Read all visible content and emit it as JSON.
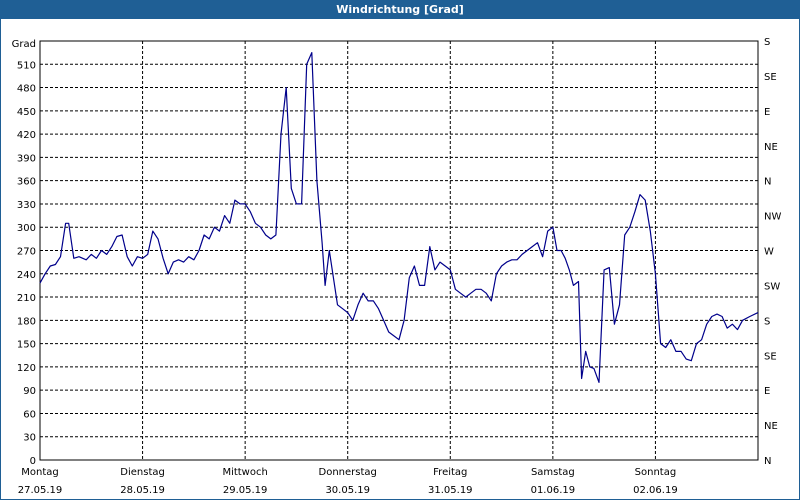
{
  "window": {
    "title": "Windrichtung [Grad]"
  },
  "chart_data": {
    "type": "line",
    "title": "Windrichtung [Grad]",
    "ylabel": "Grad",
    "ylim": [
      0,
      540
    ],
    "yticks": [
      0,
      30,
      60,
      90,
      120,
      150,
      180,
      210,
      240,
      270,
      300,
      330,
      360,
      390,
      420,
      450,
      480,
      510
    ],
    "right_axis_labels": [
      "S",
      "SE",
      "E",
      "NE",
      "N",
      "NW",
      "W",
      "SW",
      "S",
      "SE",
      "E",
      "NE",
      "N"
    ],
    "grid": true,
    "x_day_labels": [
      {
        "day": "Montag",
        "date": "27.05.19"
      },
      {
        "day": "Dienstag",
        "date": "28.05.19"
      },
      {
        "day": "Mittwoch",
        "date": "29.05.19"
      },
      {
        "day": "Donnerstag",
        "date": "30.05.19"
      },
      {
        "day": "Freitag",
        "date": "31.05.19"
      },
      {
        "day": "Samstag",
        "date": "01.06.19"
      },
      {
        "day": "Sonntag",
        "date": "02.06.19"
      }
    ],
    "line_color": "#00008b",
    "series": [
      {
        "x_days": [
          0.0,
          0.05,
          0.1,
          0.15,
          0.2,
          0.25,
          0.28,
          0.33,
          0.38,
          0.45,
          0.5,
          0.55,
          0.6,
          0.65,
          0.7,
          0.75,
          0.8,
          0.85,
          0.9,
          0.95,
          1.0,
          1.05,
          1.1,
          1.15,
          1.2,
          1.25,
          1.3,
          1.35,
          1.4,
          1.45,
          1.5,
          1.55,
          1.6,
          1.65,
          1.7,
          1.75,
          1.8,
          1.85,
          1.9,
          1.95,
          2.0,
          2.05,
          2.1,
          2.15,
          2.2,
          2.25,
          2.3,
          2.35,
          2.4,
          2.45,
          2.5,
          2.55,
          2.6,
          2.65,
          2.7,
          2.75,
          2.78,
          2.82,
          2.9,
          2.95,
          3.0,
          3.05,
          3.1,
          3.15,
          3.2,
          3.25,
          3.3,
          3.35,
          3.4,
          3.45,
          3.5,
          3.55,
          3.6,
          3.65,
          3.7,
          3.75,
          3.8,
          3.85,
          3.9,
          3.95,
          4.0,
          4.05,
          4.1,
          4.15,
          4.2,
          4.25,
          4.3,
          4.35,
          4.4,
          4.45,
          4.5,
          4.55,
          4.6,
          4.65,
          4.7,
          4.75,
          4.8,
          4.85,
          4.9,
          4.95,
          5.0,
          5.04,
          5.08,
          5.12,
          5.16,
          5.2,
          5.25,
          5.28,
          5.32,
          5.36,
          5.4,
          5.45,
          5.5,
          5.55,
          5.6,
          5.65,
          5.7,
          5.75,
          5.8,
          5.85,
          5.9,
          5.95,
          6.0,
          6.05,
          6.1,
          6.15,
          6.2,
          6.25,
          6.3,
          6.35,
          6.4,
          6.45,
          6.5,
          6.55,
          6.6,
          6.65,
          6.7,
          6.75,
          6.8,
          6.85,
          6.92,
          7.0
        ],
        "values": [
          228,
          240,
          250,
          252,
          262,
          305,
          305,
          260,
          262,
          258,
          265,
          260,
          270,
          265,
          275,
          288,
          290,
          262,
          250,
          262,
          260,
          265,
          295,
          285,
          260,
          240,
          255,
          258,
          255,
          262,
          258,
          270,
          290,
          285,
          300,
          295,
          315,
          305,
          335,
          330,
          330,
          320,
          305,
          300,
          290,
          285,
          290,
          420,
          480,
          350,
          330,
          330,
          510,
          525,
          360,
          280,
          225,
          270,
          200,
          195,
          190,
          180,
          200,
          215,
          205,
          205,
          195,
          180,
          165,
          160,
          155,
          180,
          235,
          250,
          225,
          225,
          275,
          245,
          255,
          250,
          245,
          220,
          215,
          210,
          215,
          220,
          220,
          215,
          205,
          240,
          250,
          255,
          258,
          258,
          265,
          270,
          275,
          280,
          262,
          295,
          300,
          270,
          270,
          260,
          245,
          225,
          230,
          105,
          140,
          120,
          118,
          100,
          245,
          248,
          175,
          200,
          290,
          300,
          320,
          342,
          335,
          295,
          240,
          150,
          145,
          155,
          140,
          140,
          130,
          128,
          150,
          155,
          175,
          185,
          188,
          185,
          170,
          175,
          168,
          180,
          185,
          190
        ]
      }
    ]
  }
}
